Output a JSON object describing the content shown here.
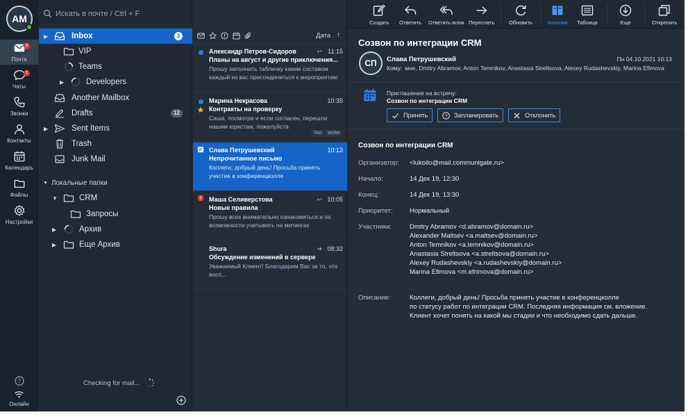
{
  "user": {
    "initials": "AM"
  },
  "rail": [
    {
      "label": "Почта",
      "badge": "3"
    },
    {
      "label": "Чаты",
      "badge": "1"
    },
    {
      "label": "Звонки"
    },
    {
      "label": "Контакты"
    },
    {
      "label": "Календарь"
    },
    {
      "label": "Файлы"
    },
    {
      "label": "Настройки"
    }
  ],
  "rail_bottom": {
    "status_label": "Онлайн"
  },
  "search": {
    "placeholder": "Искать в почте / Ctrl + F"
  },
  "folders": [
    {
      "label": "Inbox",
      "count": "3"
    },
    {
      "label": "VIP"
    },
    {
      "label": "Teams"
    },
    {
      "label": "Developers"
    },
    {
      "label": "Another Mailbox"
    },
    {
      "label": "Drafts",
      "count": "12"
    },
    {
      "label": "Sent Items"
    },
    {
      "label": "Trash"
    },
    {
      "label": "Junk Mail"
    }
  ],
  "local_section": {
    "label": "Локальные папки"
  },
  "local_folders": [
    {
      "label": "CRM"
    },
    {
      "label": "Запросы"
    },
    {
      "label": "Архив"
    },
    {
      "label": "Еще Архив"
    }
  ],
  "status": {
    "checking": "Checking for mail..."
  },
  "list": {
    "sort_label": "Дата",
    "messages": [
      {
        "from": "Александр Петров-Сидоров",
        "time": "11:15",
        "subject": "Планы на август и другие приключения...",
        "preview": "Прошу заполнить табличку каким составом каждый из вас присоединиться к мероприятию",
        "tags": []
      },
      {
        "from": "Марина Некрасова",
        "time": "10:35",
        "subject": "Контракты на проверку",
        "preview": "Саша, посмотри и если согласен, перешли нашим юристам, пожалуйста",
        "tags": [
          "TAG",
          "WORK"
        ]
      },
      {
        "from": "Слава Петрушевский",
        "time": "10:13",
        "subject": "Непрочитанное письмо",
        "preview": "Коллеги, добрый день! Просьба принять участие в конференцколле",
        "tags": []
      },
      {
        "from": "Маша Селиверстова",
        "time": "10:05",
        "subject": "Новые правила",
        "preview": "Прошу всех внимательно ознакомиться и по возможности учитывать на митингах",
        "tags": []
      },
      {
        "from": "Shura",
        "time": "08:32",
        "subject": "Обсуждение изменений в сервере",
        "preview": "Уважаемый Клиент! Благодарим Вас за то, что восп...",
        "tags": []
      }
    ]
  },
  "toolbar": {
    "create": "Создать",
    "reply": "Ответить",
    "reply_all": "Ответить всем",
    "forward": "Переслать",
    "refresh": "Обновить",
    "columns": "Колонки",
    "table": "Таблица",
    "more": "Еще",
    "open": "Открепить"
  },
  "reader": {
    "subject": "Созвон по интеграции CRM",
    "sender_initials": "СП",
    "sender_name": "Слава Петрушевский",
    "date": "Пн 04.10.2021 10:13",
    "to_label": "Кому:",
    "to": "мне, Dmitry Abramov, Anton Temnikov, Anastasia Streltsova, Alexey Rudashevskiy, Marina Efimova",
    "invite_label": "Приглашение на встречу:",
    "invite_title": "Созвон по интеграции CRM",
    "accept": "Принять",
    "tentative": "Запланировать",
    "decline": "Отклонить",
    "body_title": "Созвон по интеграции CRM",
    "fields": {
      "organizer_label": "Организатор:",
      "organizer": "<lukoilo@mail.communigate.ru>",
      "start_label": "Начало:",
      "start": "14 Дек 19, 12:30",
      "end_label": "Конец:",
      "end": "14 Дек 19, 13:30",
      "priority_label": "Приоритет:",
      "priority": "Нормальный",
      "participants_label": "Участники:",
      "participants": [
        "Dmitry Abramov <d.abramov@domain.ru>",
        "Alexander Maltsev <a.maltsev@domain.ru>",
        "Anton Temnikov <a.temnikov@domain.ru>",
        "Anastasia Streltsova <a.streltsova@domain.ru>",
        "Alexey Rudashevskiy <a.rudashevskiy@domain.ru>",
        "Marina Efimova <m.efrimova@domain.ru>"
      ],
      "description_label": "Описание:",
      "description": [
        "Коллеги, добрый день! Просьба принять участие в конференцколле",
        "по статусу работ по интеграции CRM. Последняя информация см. вложение.",
        "Клиент хочет понять на какой мы стадии и что необходимо сдать дальше."
      ]
    }
  },
  "colors": {
    "accent": "#1565c9",
    "unread_dot": "#2f7be0",
    "important": "#e13b3b",
    "star": "#f0b429"
  }
}
